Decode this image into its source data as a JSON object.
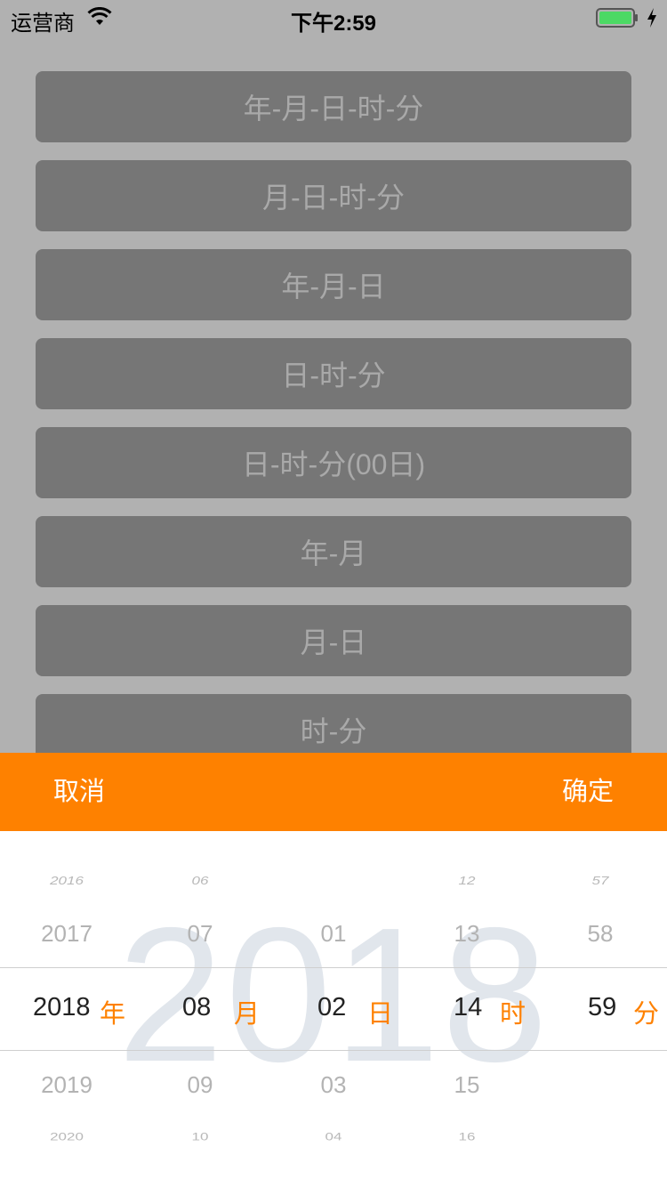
{
  "status_bar": {
    "carrier": "运营商",
    "time": "下午2:59"
  },
  "format_buttons": [
    "年-月-日-时-分",
    "月-日-时-分",
    "年-月-日",
    "日-时-分",
    "日-时-分(00日)",
    "年-月",
    "月-日",
    "时-分"
  ],
  "toolbar": {
    "cancel_label": "取消",
    "confirm_label": "确定",
    "background_color": "#fe8100"
  },
  "picker": {
    "watermark": "2018",
    "accent_color": "#fe8100",
    "columns": [
      {
        "name": "year",
        "above2": "2016",
        "above1": "2017",
        "selected": "2018",
        "unit": "年",
        "below1": "2019",
        "below2": "2020"
      },
      {
        "name": "month",
        "above2": "06",
        "above1": "07",
        "selected": "08",
        "unit": "月",
        "below1": "09",
        "below2": "10"
      },
      {
        "name": "day",
        "above2": "",
        "above1": "01",
        "selected": "02",
        "unit": "日",
        "below1": "03",
        "below2": "04"
      },
      {
        "name": "hour",
        "above2": "12",
        "above1": "13",
        "selected": "14",
        "unit": "时",
        "below1": "15",
        "below2": "16"
      },
      {
        "name": "minute",
        "above2": "57",
        "above1": "58",
        "selected": "59",
        "unit": "分",
        "below1": "",
        "below2": ""
      }
    ]
  }
}
